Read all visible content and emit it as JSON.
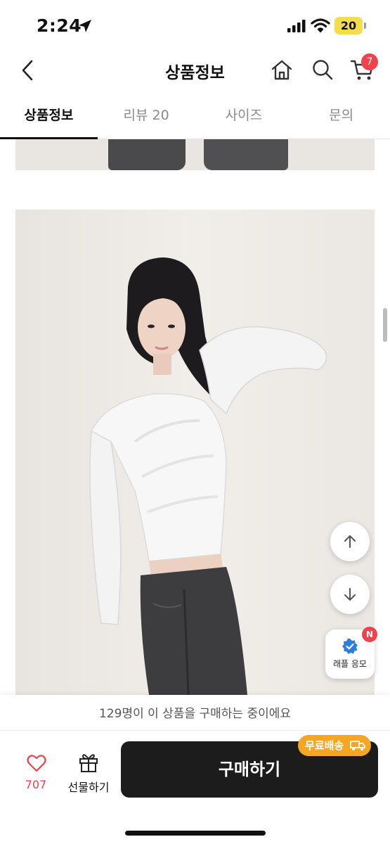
{
  "status_bar": {
    "time": "2:24",
    "battery": "20"
  },
  "nav": {
    "title": "상품정보",
    "cart_count": "7"
  },
  "tabs": [
    {
      "label": "상품정보",
      "active": true
    },
    {
      "label": "리뷰 20",
      "active": false
    },
    {
      "label": "사이즈",
      "active": false
    },
    {
      "label": "문의",
      "active": false
    }
  ],
  "floating": {
    "raffle_label": "래플 응모",
    "raffle_badge": "N"
  },
  "bottom_bar": {
    "purchase_notice": "129명이 이 상품을 구매하는 중이에요",
    "like_count": "707",
    "gift_label": "선물하기",
    "buy_label": "구매하기",
    "shipping_badge": "무료배송"
  },
  "colors": {
    "accent_red": "#f0414d",
    "buy_button": "#1c1c1c",
    "shipping_badge": "#f6a623",
    "battery": "#f4dc4a"
  }
}
